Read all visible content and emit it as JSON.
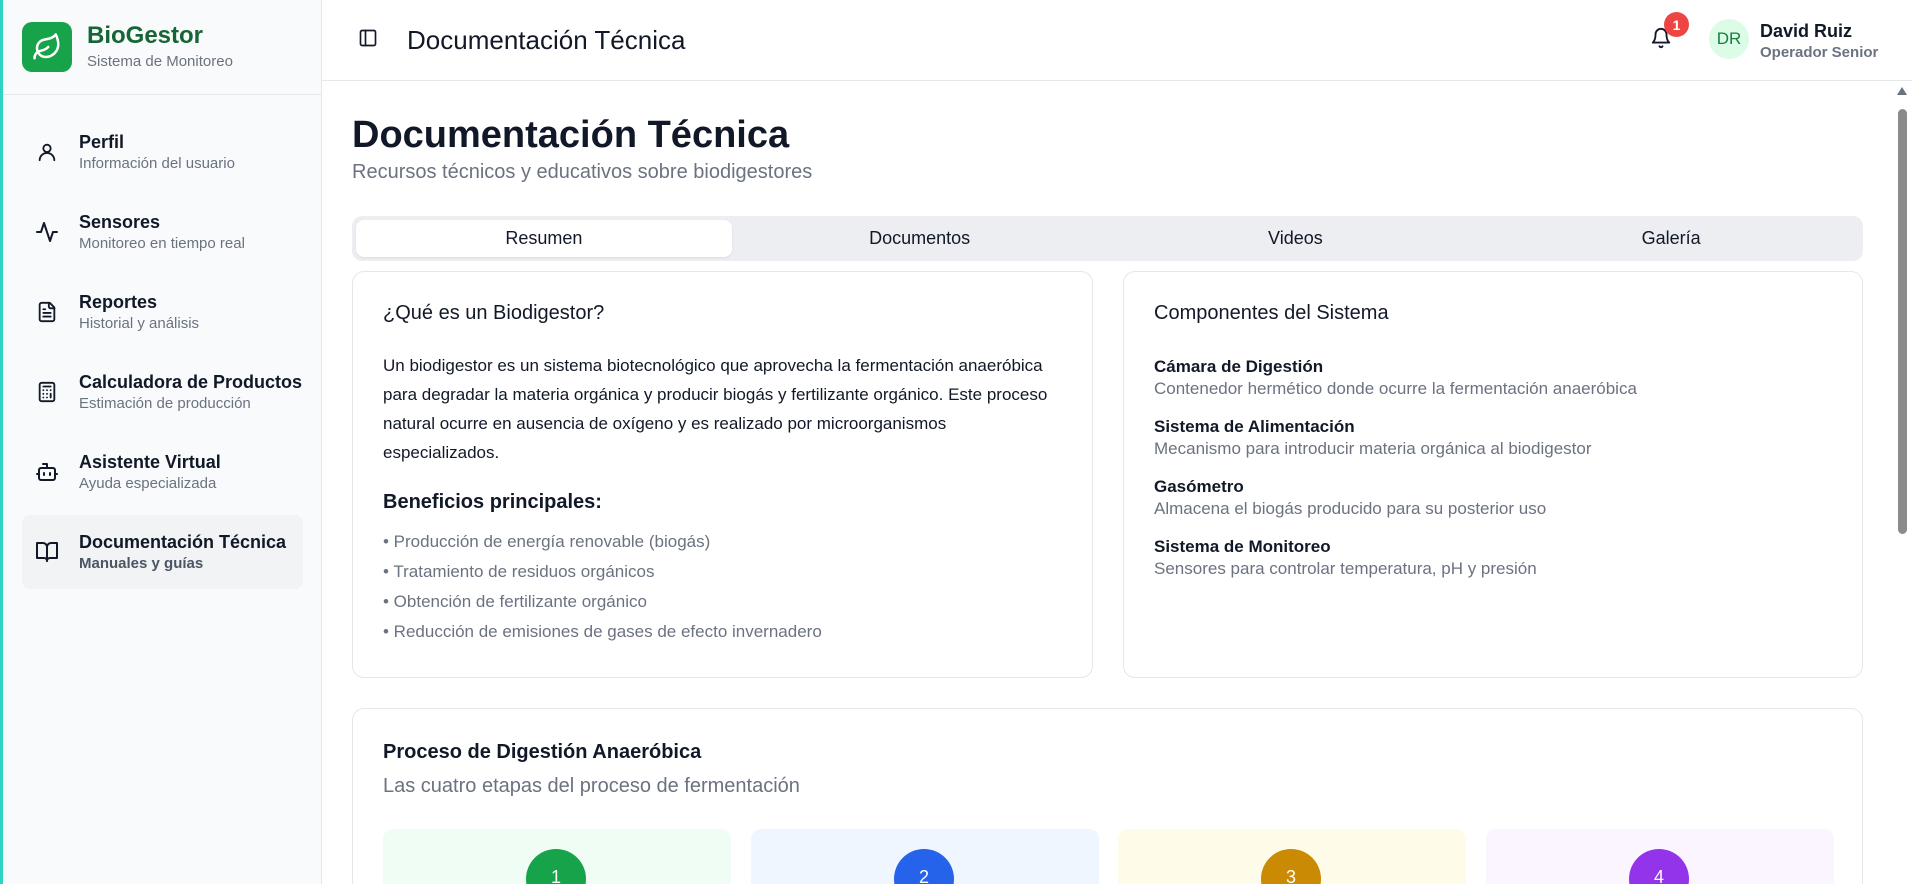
{
  "app": {
    "name": "BioGestor",
    "subtitle": "Sistema de Monitoreo"
  },
  "sidebar": {
    "items": [
      {
        "label": "Perfil",
        "sub": "Información del usuario",
        "icon": "user-icon"
      },
      {
        "label": "Sensores",
        "sub": "Monitoreo en tiempo real",
        "icon": "activity-icon"
      },
      {
        "label": "Reportes",
        "sub": "Historial y análisis",
        "icon": "file-text-icon"
      },
      {
        "label": "Calculadora de Productos",
        "sub": "Estimación de producción",
        "icon": "calculator-icon"
      },
      {
        "label": "Asistente Virtual",
        "sub": "Ayuda especializada",
        "icon": "bot-icon"
      },
      {
        "label": "Documentación Técnica",
        "sub": "Manuales y guías",
        "icon": "book-open-icon",
        "active": true
      }
    ]
  },
  "header": {
    "title": "Documentación Técnica",
    "notifications": "1",
    "user": {
      "initials": "DR",
      "name": "David Ruiz",
      "role": "Operador Senior"
    }
  },
  "page": {
    "title": "Documentación Técnica",
    "subtitle": "Recursos técnicos y educativos sobre biodigestores",
    "tabs": [
      "Resumen",
      "Documentos",
      "Videos",
      "Galería"
    ],
    "active_tab": "Resumen"
  },
  "what_is": {
    "title": "¿Qué es un Biodigestor?",
    "body": "Un biodigestor es un sistema biotecnológico que aprovecha la fermentación anaeróbica para degradar la materia orgánica y producir biogás y fertilizante orgánico. Este proceso natural ocurre en ausencia de oxígeno y es realizado por microorganismos especializados.",
    "benefits_title": "Beneficios principales:",
    "benefits": [
      "• Producción de energía renovable (biogás)",
      "• Tratamiento de residuos orgánicos",
      "• Obtención de fertilizante orgánico",
      "• Reducción de emisiones de gases de efecto invernadero"
    ]
  },
  "components": {
    "title": "Componentes del Sistema",
    "items": [
      {
        "name": "Cámara de Digestión",
        "desc": "Contenedor hermético donde ocurre la fermentación anaeróbica"
      },
      {
        "name": "Sistema de Alimentación",
        "desc": "Mecanismo para introducir materia orgánica al biodigestor"
      },
      {
        "name": "Gasómetro",
        "desc": "Almacena el biogás producido para su posterior uso"
      },
      {
        "name": "Sistema de Monitoreo",
        "desc": "Sensores para controlar temperatura, pH y presión"
      }
    ]
  },
  "process": {
    "title": "Proceso de Digestión Anaeróbica",
    "subtitle": "Las cuatro etapas del proceso de fermentación",
    "steps": [
      {
        "num": "1",
        "bg": "#f0fdf4",
        "color": "#16a34a"
      },
      {
        "num": "2",
        "bg": "#eff6ff",
        "color": "#2563eb"
      },
      {
        "num": "3",
        "bg": "#fefce8",
        "color": "#ca8a04"
      },
      {
        "num": "4",
        "bg": "#faf5ff",
        "color": "#9333ea"
      }
    ]
  },
  "colors": {
    "brand": "#16a34a",
    "brand_dark": "#166534",
    "badge": "#ef4444"
  }
}
